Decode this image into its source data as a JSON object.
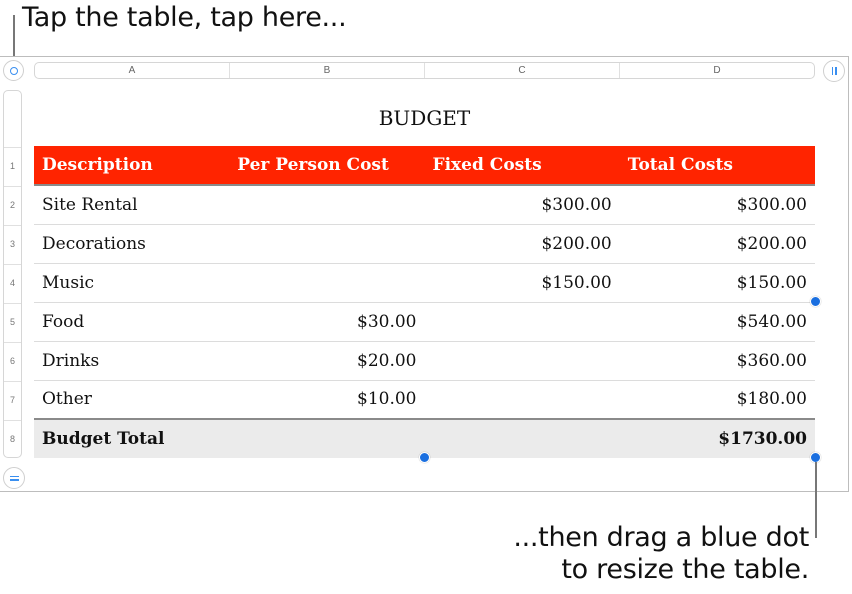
{
  "callouts": {
    "top": "Tap the table, tap here...",
    "bottom_line1": "...then drag a blue dot",
    "bottom_line2": "to resize the table."
  },
  "controls": {
    "select_table_icon": "circle-select-icon",
    "add_column_icon": "column-handle-icon",
    "add_row_icon": "row-handle-icon",
    "accent_color": "#3a8ff0",
    "handle_color": "#1a6fe0"
  },
  "column_headers": [
    "A",
    "B",
    "C",
    "D"
  ],
  "row_headers": [
    "1",
    "2",
    "3",
    "4",
    "5",
    "6",
    "7",
    "8"
  ],
  "table": {
    "title": "BUDGET",
    "header_color": "#ff2400",
    "header": [
      "Description",
      "Per Person Cost",
      "Fixed Costs",
      "Total Costs"
    ],
    "rows": [
      [
        "Site Rental",
        "",
        "$300.00",
        "$300.00"
      ],
      [
        "Decorations",
        "",
        "$200.00",
        "$200.00"
      ],
      [
        "Music",
        "",
        "$150.00",
        "$150.00"
      ],
      [
        "Food",
        "$30.00",
        "",
        "$540.00"
      ],
      [
        "Drinks",
        "$20.00",
        "",
        "$360.00"
      ],
      [
        "Other",
        "$10.00",
        "",
        "$180.00"
      ]
    ],
    "footer": [
      "Budget Total",
      "",
      "",
      "$1730.00"
    ]
  }
}
